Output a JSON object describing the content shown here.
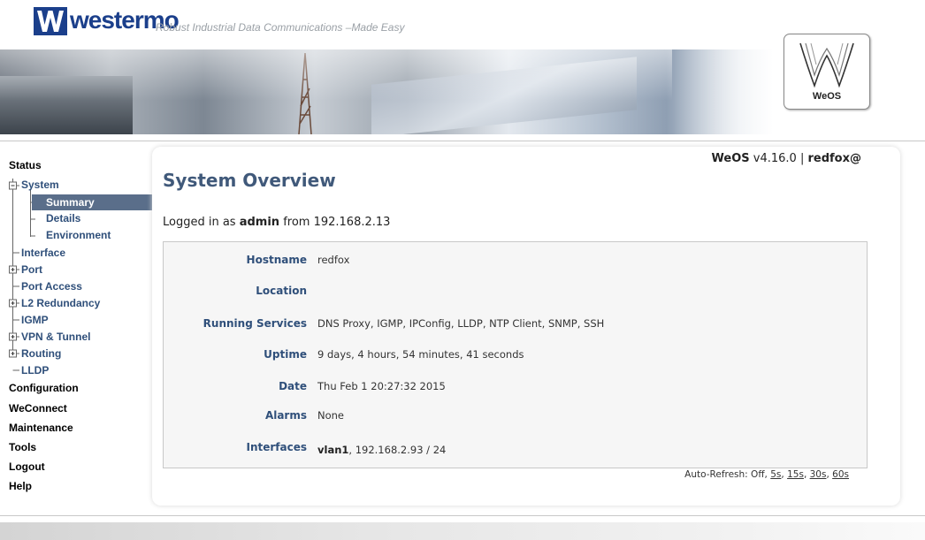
{
  "header": {
    "logo_text": "westermo",
    "tagline": "Robust Industrial Data Communications –Made Easy",
    "badge_label": "WeOS"
  },
  "nav": {
    "status": "Status",
    "system": "System",
    "summary": "Summary",
    "details": "Details",
    "environment": "Environment",
    "interface": "Interface",
    "port": "Port",
    "port_access": "Port Access",
    "l2_redundancy": "L2 Redundancy",
    "igmp": "IGMP",
    "vpn_tunnel": "VPN & Tunnel",
    "routing": "Routing",
    "lldp": "LLDP",
    "configuration": "Configuration",
    "weconnect": "WeConnect",
    "maintenance": "Maintenance",
    "tools": "Tools",
    "logout": "Logout",
    "help": "Help"
  },
  "version": {
    "product": "WeOS",
    "version": "v4.16.0 |",
    "host": "redfox@"
  },
  "page": {
    "title": "System Overview",
    "login_prefix": "Logged in as",
    "login_user": "admin",
    "login_suffix": "from 192.168.2.13"
  },
  "info": {
    "hostname_label": "Hostname",
    "hostname": "redfox",
    "location_label": "Location",
    "location": "",
    "services_label": "Running Services",
    "services": "DNS Proxy, IGMP, IPConfig, LLDP, NTP Client, SNMP, SSH",
    "uptime_label": "Uptime",
    "uptime": "9 days, 4 hours, 54 minutes, 41 seconds",
    "date_label": "Date",
    "date": "Thu Feb 1 20:27:32 2015",
    "alarms_label": "Alarms",
    "alarms": "None",
    "interfaces_label": "Interfaces",
    "interface_name": "vlan1",
    "interface_addr": ", 192.168.2.93 / 24"
  },
  "autorefresh": {
    "label": "Auto-Refresh: Off,",
    "opt5": "5s",
    "opt15": "15s",
    "opt30": "30s",
    "opt60": "60s"
  },
  "colors": {
    "brand": "#1b3f8b",
    "heading": "#40597a",
    "nav_selected_bg": "#5a6e8a"
  }
}
